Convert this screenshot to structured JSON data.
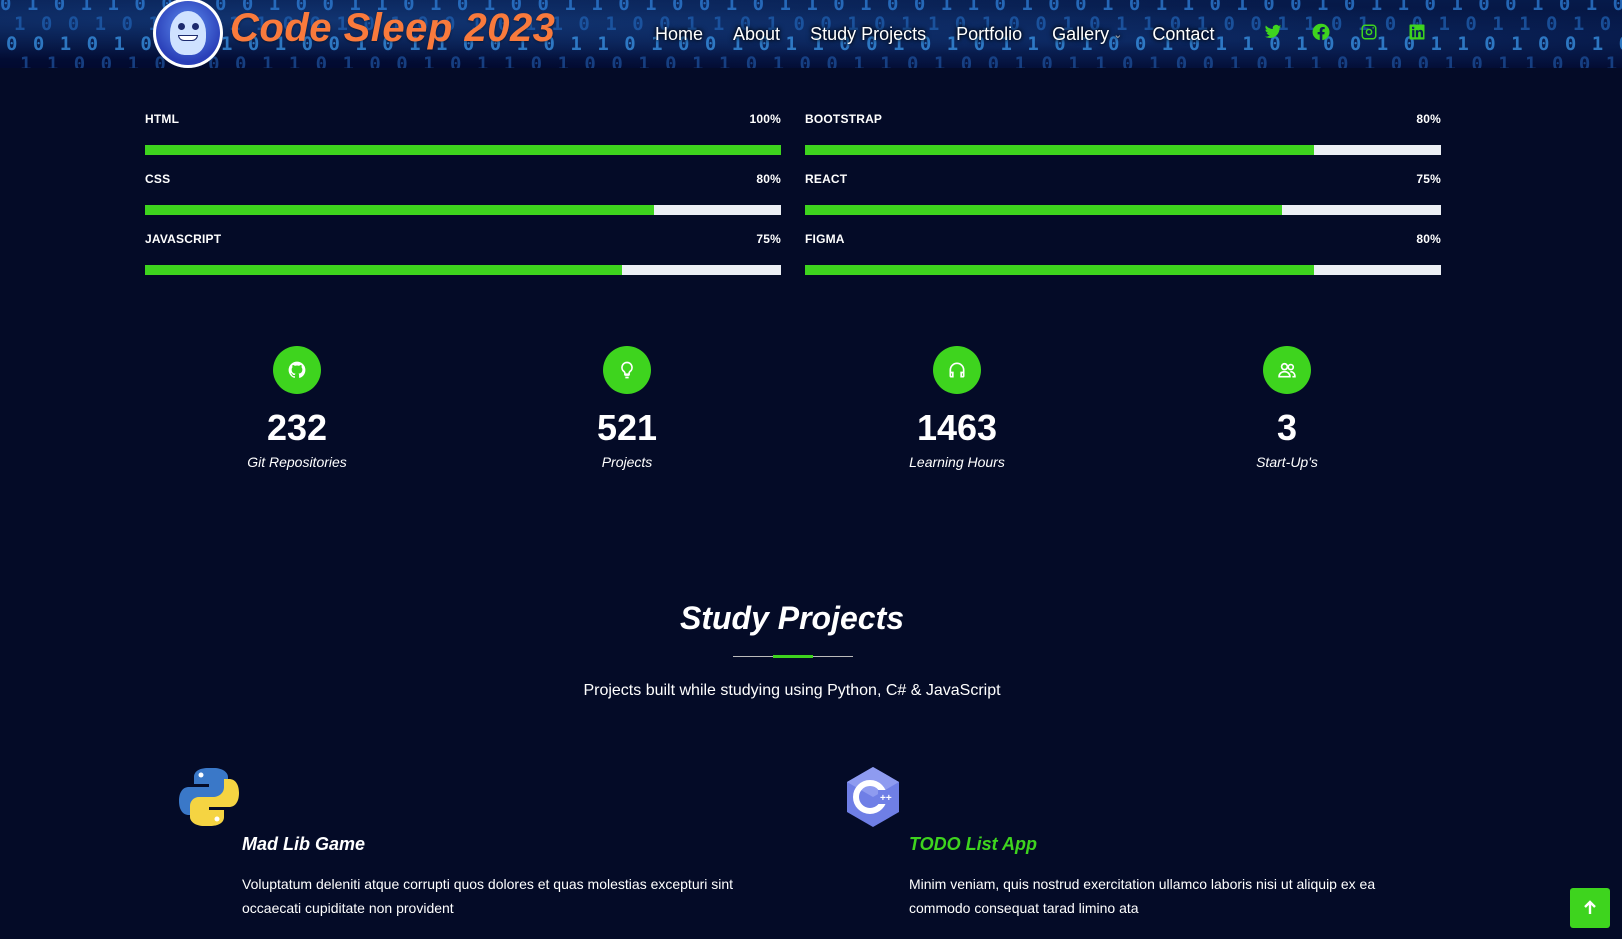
{
  "header": {
    "brand": "Code Sleep 2023",
    "nav": [
      {
        "label": "Home"
      },
      {
        "label": "About"
      },
      {
        "label": "Study Projects"
      },
      {
        "label": "Portfolio"
      },
      {
        "label": "Gallery"
      },
      {
        "label": "Contact"
      }
    ],
    "social_icons": [
      "twitter-icon",
      "facebook-icon",
      "instagram-icon",
      "linkedin-icon"
    ]
  },
  "skills": [
    {
      "name": "HTML",
      "percent_label": "100%",
      "value": 100
    },
    {
      "name": "BOOTSTRAP",
      "percent_label": "80%",
      "value": 80
    },
    {
      "name": "CSS",
      "percent_label": "80%",
      "value": 80
    },
    {
      "name": "REACT",
      "percent_label": "75%",
      "value": 75
    },
    {
      "name": "JAVASCRIPT",
      "percent_label": "75%",
      "value": 75
    },
    {
      "name": "FIGMA",
      "percent_label": "80%",
      "value": 80
    }
  ],
  "stats": [
    {
      "icon": "github-icon",
      "number": "232",
      "label": "Git Repositories"
    },
    {
      "icon": "lightbulb-icon",
      "number": "521",
      "label": "Projects"
    },
    {
      "icon": "headset-icon",
      "number": "1463",
      "label": "Learning Hours"
    },
    {
      "icon": "people-icon",
      "number": "3",
      "label": "Start-Up's"
    }
  ],
  "section": {
    "title": "Study Projects",
    "subtitle": "Projects built while studying using Python, C# & JavaScript"
  },
  "projects": [
    {
      "icon": "python-logo-icon",
      "title": "Mad Lib Game",
      "desc": "Voluptatum deleniti atque corrupti quos dolores et quas molestias excepturi sint occaecati cupiditate non provident"
    },
    {
      "icon": "cpp-logo-icon",
      "title": "TODO List App",
      "desc": "Minim veniam, quis nostrud exercitation ullamco laboris nisi ut aliquip ex ea commodo consequat tarad limino ata"
    }
  ],
  "colors": {
    "background": "#040b27",
    "accent": "#3ed41e",
    "brand": "#f97a3c",
    "track": "#eceff4"
  }
}
